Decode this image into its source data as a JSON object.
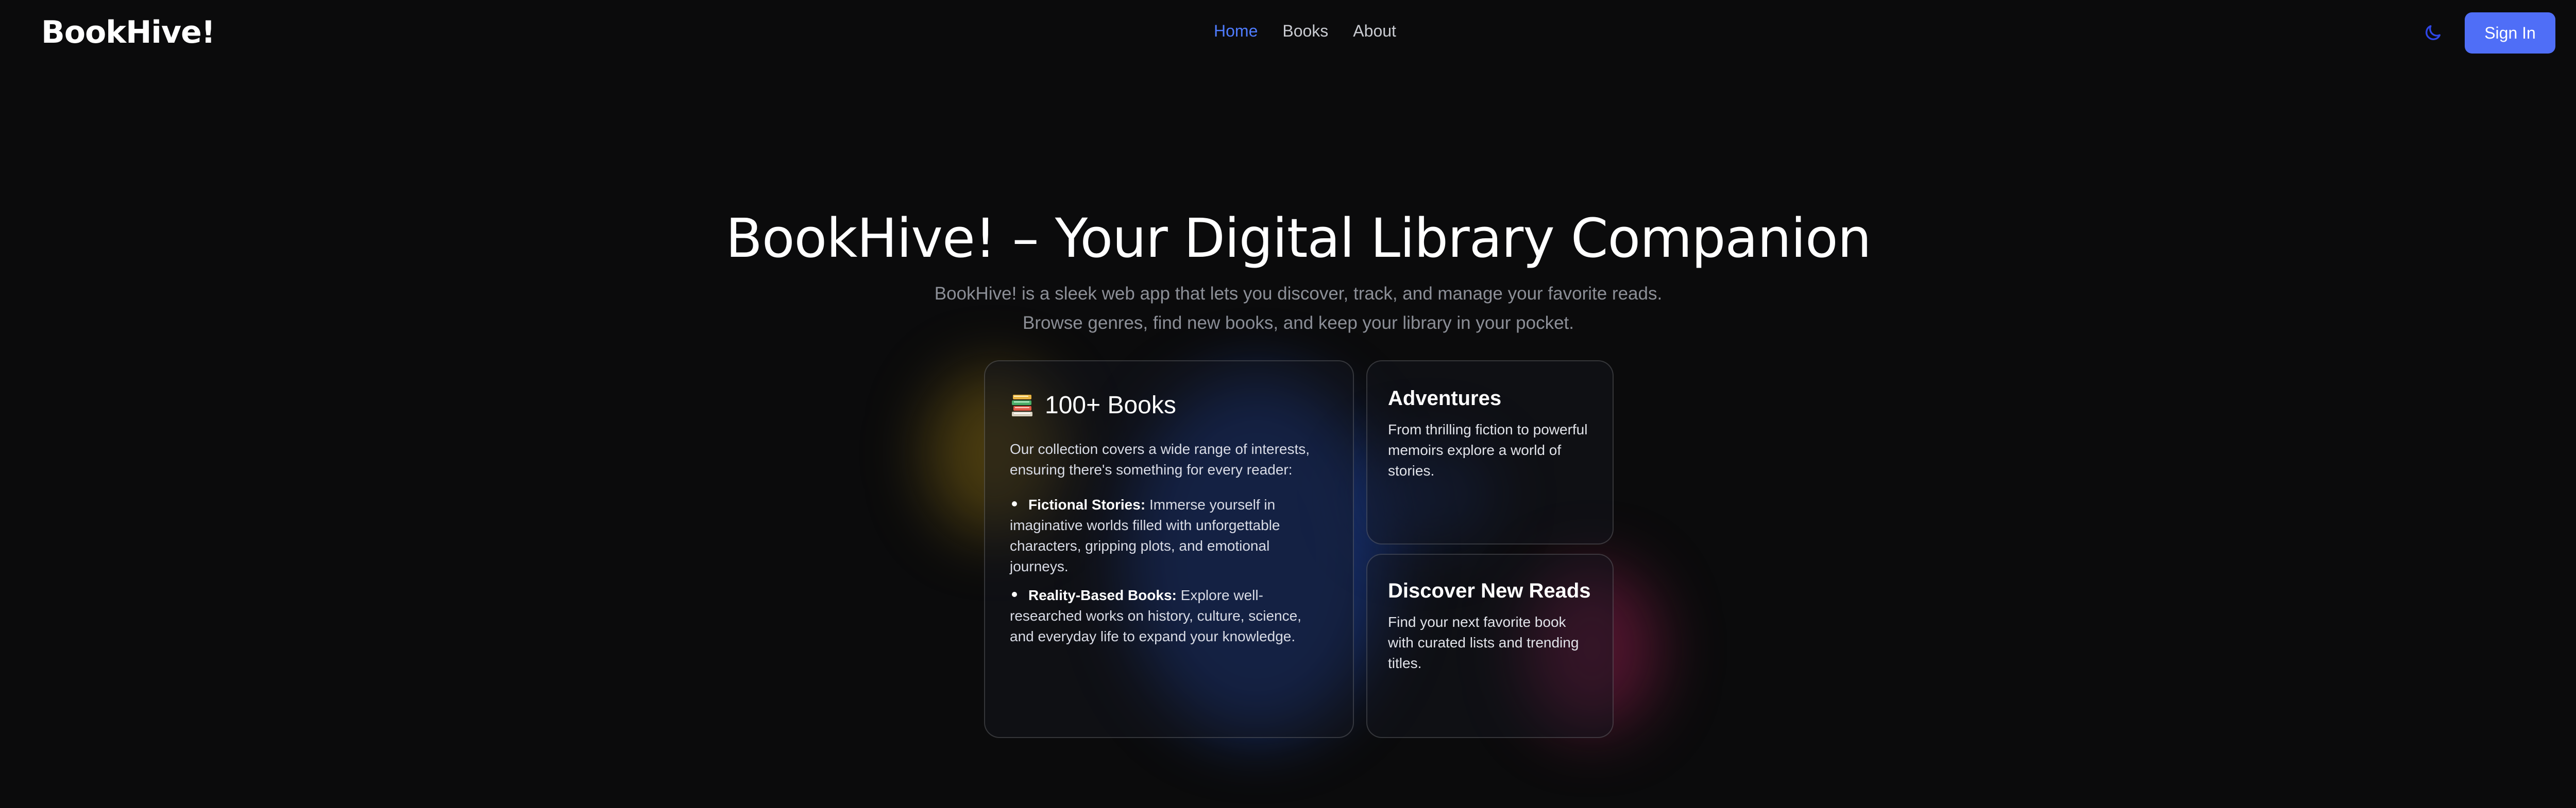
{
  "navbar": {
    "brand": "BookHive!",
    "links": [
      {
        "label": "Home",
        "active": true
      },
      {
        "label": "Books",
        "active": false
      },
      {
        "label": "About",
        "active": false
      }
    ],
    "theme_toggle_icon": "moon-icon",
    "sign_in": "Sign In",
    "accent_color": "#4f7cff",
    "button_color": "#4f6ef7"
  },
  "hero": {
    "title": "BookHive! – Your Digital Library Companion",
    "subtitle_line1": "BookHive! is a sleek web app that lets you discover, track, and manage your favorite reads.",
    "subtitle_line2": "Browse genres, find new books, and keep your library in your pocket."
  },
  "cards": {
    "main": {
      "icon": "books-icon",
      "title": "100+ Books",
      "intro": "Our collection covers a wide range of interests, ensuring there's something for every reader:",
      "bullets": [
        {
          "label": "Fictional Stories:",
          "text": "Immerse yourself in imaginative worlds filled with unforgettable characters, gripping plots, and emotional journeys."
        },
        {
          "label": "Reality-Based Books:",
          "text": "Explore well-researched works on history, culture, science, and everyday life to expand your knowledge."
        }
      ]
    },
    "adventures": {
      "title": "Adventures",
      "text": "From thrilling fiction to powerful memoirs explore a world of stories."
    },
    "discover": {
      "title": "Discover New Reads",
      "text": "Find your next favorite book with curated lists and trending titles."
    }
  }
}
